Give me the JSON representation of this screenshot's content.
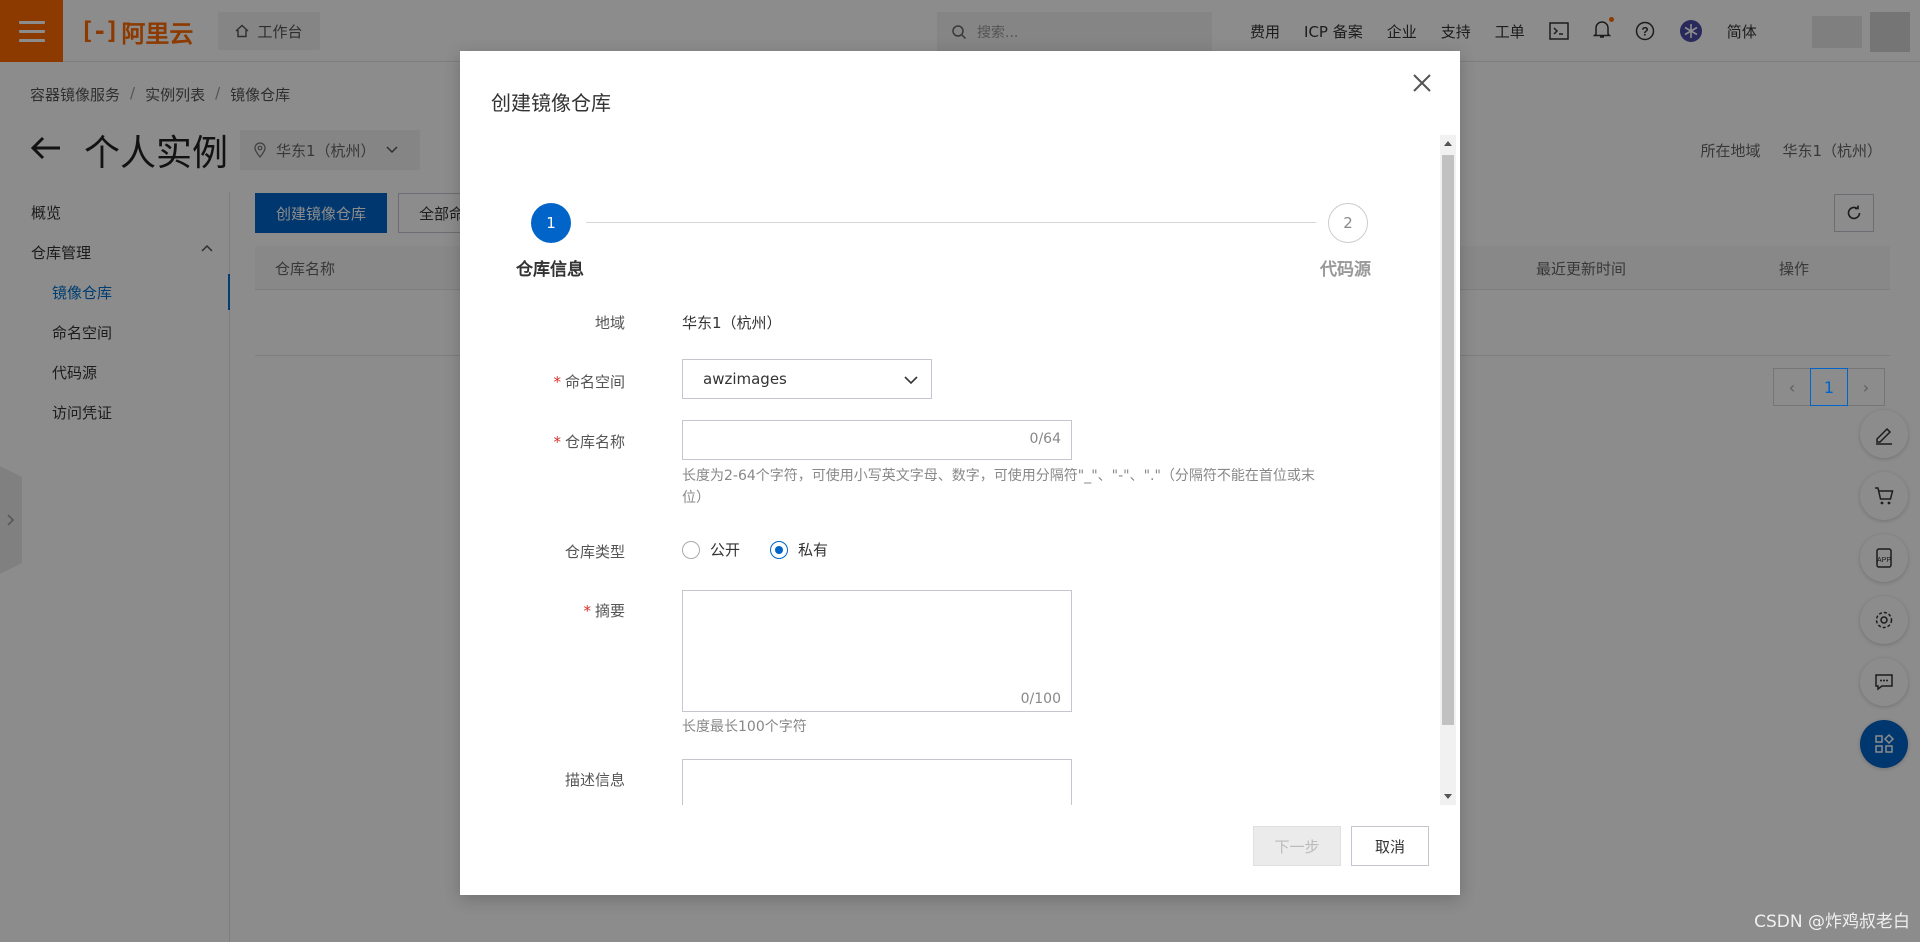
{
  "topbar": {
    "logo_text": "阿里云",
    "logo_mark": "[-]",
    "workbench_label": "工作台",
    "search_placeholder": "搜索...",
    "nav_items": [
      "费用",
      "ICP 备案",
      "企业",
      "支持",
      "工单"
    ],
    "lang_label": "简体"
  },
  "breadcrumb": [
    "容器镜像服务",
    "实例列表",
    "镜像仓库"
  ],
  "page": {
    "title": "个人实例",
    "region_select": "华东1（杭州）",
    "region_label": "所在地域",
    "region_value": "华东1（杭州）"
  },
  "sidebar": {
    "overview": "概览",
    "repo_mgmt": "仓库管理",
    "items": [
      "镜像仓库",
      "命名空间",
      "代码源",
      "访问凭证"
    ]
  },
  "main": {
    "create_button": "创建镜像仓库",
    "all_button": "全部命",
    "columns": {
      "name": "仓库名称",
      "updated": "最近更新时间",
      "actions": "操作"
    },
    "pager_current": "1"
  },
  "modal": {
    "title": "创建镜像仓库",
    "steps": [
      {
        "num": "1",
        "label": "仓库信息"
      },
      {
        "num": "2",
        "label": "代码源"
      }
    ],
    "region": {
      "label": "地域",
      "value": "华东1（杭州）"
    },
    "namespace": {
      "label": "命名空间",
      "value": "awzimages"
    },
    "repo_name": {
      "label": "仓库名称",
      "counter": "0/64",
      "hint": "长度为2-64个字符，可使用小写英文字母、数字，可使用分隔符\"_\"、\"-\"、\".\"（分隔符不能在首位或末位）"
    },
    "repo_type": {
      "label": "仓库类型",
      "public": "公开",
      "private": "私有",
      "selected": "私有"
    },
    "summary": {
      "label": "摘要",
      "counter": "0/100",
      "hint": "长度最长100个字符"
    },
    "description": {
      "label": "描述信息"
    },
    "next_button": "下一步",
    "cancel_button": "取消"
  },
  "watermark": "CSDN @炸鸡叔老白",
  "colors": {
    "brand": "#ff6a00",
    "primary": "#0064c8"
  }
}
